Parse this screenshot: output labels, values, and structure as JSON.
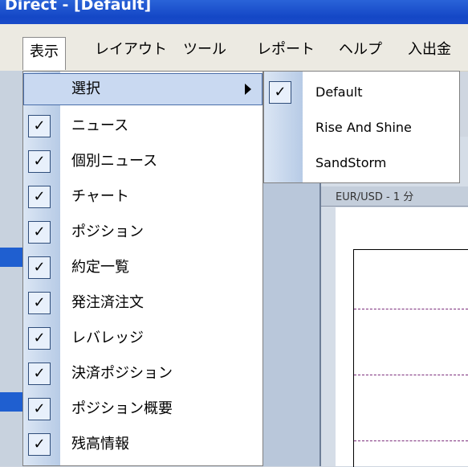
{
  "window": {
    "title": "Direct - [Default]"
  },
  "menubar": {
    "items": [
      {
        "label": "表示",
        "active": true
      },
      {
        "label": "レイアウト"
      },
      {
        "label": "ツール"
      },
      {
        "label": "レポート"
      },
      {
        "label": "ヘルプ"
      },
      {
        "label": "入出金"
      }
    ]
  },
  "view_menu": {
    "submenu_item": {
      "label": "選択"
    },
    "items": [
      {
        "label": "ニュース",
        "checked": true
      },
      {
        "label": "個別ニュース",
        "checked": true
      },
      {
        "label": "チャート",
        "checked": true
      },
      {
        "label": "ポジション",
        "checked": true
      },
      {
        "label": "約定一覧",
        "checked": true
      },
      {
        "label": "発注済注文",
        "checked": true
      },
      {
        "label": "レバレッジ",
        "checked": true
      },
      {
        "label": "決済ポジション",
        "checked": true
      },
      {
        "label": "ポジション概要",
        "checked": true
      },
      {
        "label": "残高情報",
        "checked": true
      }
    ]
  },
  "layout_submenu": {
    "items": [
      {
        "label": "Default",
        "checked": true
      },
      {
        "label": "Rise And Shine",
        "checked": false
      },
      {
        "label": "SandStorm",
        "checked": false
      }
    ]
  },
  "chart_panel": {
    "header": "EUR/USD - 1 分"
  },
  "icons": {
    "check": "✓"
  },
  "colors": {
    "titlebar": "#1447c6",
    "highlight": "#c9d9f1",
    "gutter": "#b7cbe6"
  }
}
